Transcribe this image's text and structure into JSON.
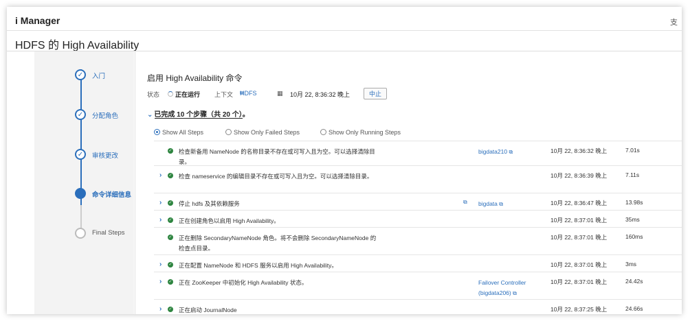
{
  "app": {
    "title": "i Manager",
    "top_right": "支"
  },
  "page": {
    "title": "HDFS 的 High Availability"
  },
  "wizard": {
    "steps": [
      {
        "label": "入门",
        "state": "done"
      },
      {
        "label": "分配角色",
        "state": "done"
      },
      {
        "label": "审核更改",
        "state": "done"
      },
      {
        "label": "命令详细信息",
        "state": "current"
      },
      {
        "label": "Final Steps",
        "state": "pending"
      }
    ]
  },
  "command": {
    "title": "启用 High Availability 命令",
    "status_label": "状态",
    "status_value": "正在运行",
    "context_label": "上下文",
    "context_value": "HDFS",
    "timestamp": "10月 22, 8:36:32 晚上",
    "stop_label": "中止",
    "summary": "已完成 10 个步骤（共 20 个）。"
  },
  "filters": {
    "options": [
      "Show All Steps",
      "Show Only Failed Steps",
      "Show Only Running Steps"
    ],
    "selected": "Show All Steps"
  },
  "steps": [
    {
      "desc": "检查新备用 NameNode 的名称目录不存在或可写入且为空。可以选择清除目录。",
      "host": "bigdata210",
      "time": "10月 22, 8:36:32 晚上",
      "duration": "7.01s",
      "expandable": false
    },
    {
      "desc": "检查 nameservice 的编辑目录不存在或可写入且为空。可以选择清除目录。",
      "host": "",
      "time": "10月 22, 8:36:39 晚上",
      "duration": "7.11s",
      "expandable": true
    },
    {
      "desc": "停止 hdfs 及其依赖服务",
      "host": "bigdata",
      "time": "10月 22, 8:36:47 晚上",
      "duration": "13.98s",
      "expandable": true
    },
    {
      "desc": "正在创建角色以启用 High Availability。",
      "host": "",
      "time": "10月 22, 8:37:01 晚上",
      "duration": "35ms",
      "expandable": true
    },
    {
      "desc": "正在删除 SecondaryNameNode 角色。将不会删除 SecondaryNameNode 的检查点目录。",
      "host": "",
      "time": "10月 22, 8:37:01 晚上",
      "duration": "160ms",
      "expandable": false
    },
    {
      "desc": "正在配置 NameNode 和 HDFS 服务以启用 High Availability。",
      "host": "",
      "time": "10月 22, 8:37:01 晚上",
      "duration": "3ms",
      "expandable": true
    },
    {
      "desc": "正在 ZooKeeper 中初始化 High Availability 状态。",
      "host": "Failover Controller (bigdata206)",
      "time": "10月 22, 8:37:01 晚上",
      "duration": "24.42s",
      "expandable": true
    },
    {
      "desc": "正在启动 JournalNode",
      "host": "",
      "time": "10月 22, 8:37:25 晚上",
      "duration": "24.66s",
      "expandable": true
    }
  ]
}
